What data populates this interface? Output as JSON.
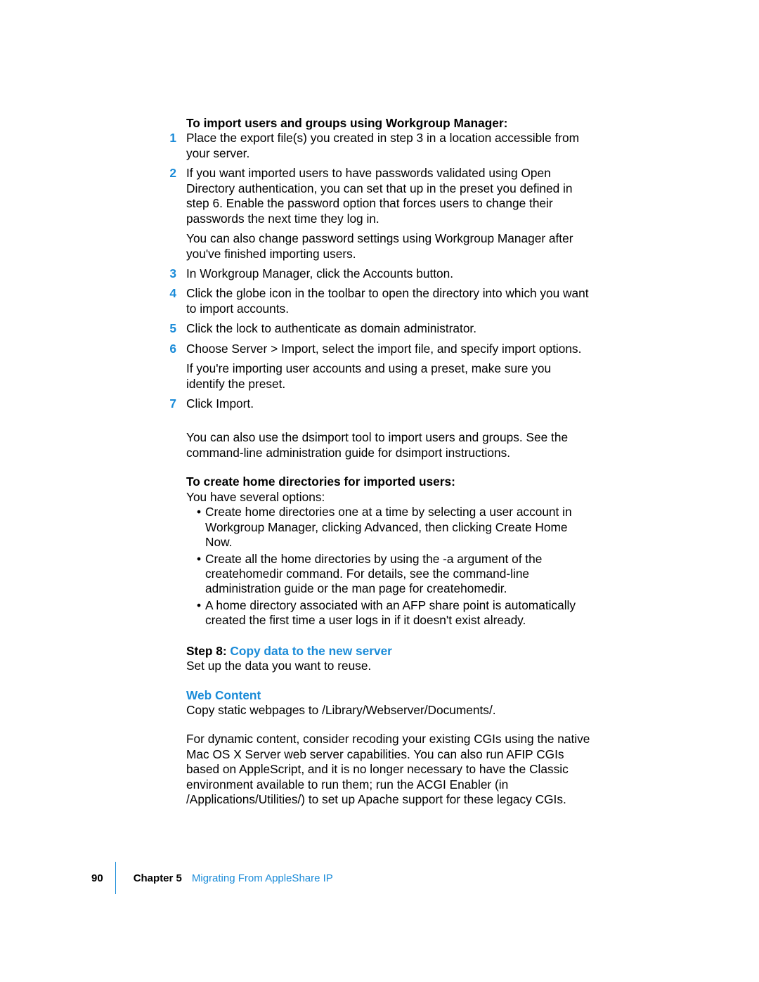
{
  "section1": {
    "heading": "To import users and groups using Workgroup Manager:",
    "steps": [
      {
        "n": "1",
        "paras": [
          "Place the export file(s) you created in step 3 in a location accessible from your server."
        ]
      },
      {
        "n": "2",
        "paras": [
          "If you want imported users to have passwords validated using Open Directory authentication, you can set that up in the preset you defined in step 6. Enable the password option that forces users to change their passwords the next time they log in.",
          "You can also change password settings using Workgroup Manager after you've finished importing users."
        ]
      },
      {
        "n": "3",
        "paras": [
          "In Workgroup Manager, click the Accounts button."
        ]
      },
      {
        "n": "4",
        "paras": [
          "Click the globe icon in the toolbar to open the directory into which you want to import accounts."
        ]
      },
      {
        "n": "5",
        "paras": [
          "Click the lock to authenticate as domain administrator."
        ]
      },
      {
        "n": "6",
        "paras": [
          "Choose Server > Import, select the import file, and specify import options.",
          "If you're importing user accounts and using a preset, make sure you identify the preset."
        ]
      },
      {
        "n": "7",
        "paras": [
          "Click Import."
        ]
      }
    ],
    "tail": "You can also use the dsimport tool to import users and groups. See the command-line administration guide for dsimport instructions."
  },
  "section2": {
    "heading": "To create home directories for imported users:",
    "intro": "You have several options:",
    "bullets": [
      "Create home directories one at a time by selecting a user account in Workgroup Manager, clicking Advanced, then clicking Create Home Now.",
      "Create all the home directories by using the -a argument of the createhomedir command. For details, see the command-line administration guide or the man page for createhomedir.",
      "A home directory associated with an AFP share point is automatically created the first time a user logs in if it doesn't exist already."
    ]
  },
  "step8": {
    "label_black": "Step 8:  ",
    "label_blue": "Copy data to the new server",
    "body": "Set up the data you want to reuse."
  },
  "web": {
    "heading": "Web Content",
    "p1": "Copy static webpages to /Library/Webserver/Documents/.",
    "p2": "For dynamic content, consider recoding your existing CGIs using the native Mac OS X Server web server capabilities. You can also run AFIP CGIs based on AppleScript, and it is no longer necessary to have the Classic environment available to run them; run the ACGI Enabler (in /Applications/Utilities/) to set up Apache support for these legacy CGIs."
  },
  "footer": {
    "page": "90",
    "chapter_bold": "Chapter 5",
    "chapter_title": "Migrating From AppleShare IP"
  }
}
